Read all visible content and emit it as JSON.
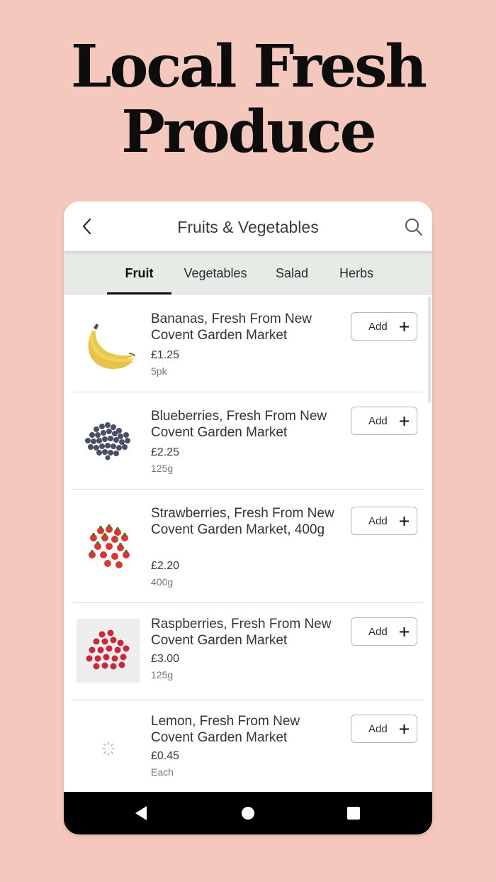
{
  "hero": {
    "line1": "Local Fresh",
    "line2": "Produce"
  },
  "appbar": {
    "title": "Fruits & Vegetables",
    "back_icon": "back-arrow-icon",
    "search_icon": "search-icon"
  },
  "tabs": [
    {
      "label": "Fruit",
      "active": true
    },
    {
      "label": "Vegetables",
      "active": false
    },
    {
      "label": "Salad",
      "active": false
    },
    {
      "label": "Herbs",
      "active": false
    }
  ],
  "products": [
    {
      "name": "Bananas, Fresh From New Covent Garden Market",
      "price": "£1.25",
      "qty": "5pk",
      "add_label": "Add"
    },
    {
      "name": "Blueberries, Fresh From New Covent Garden Market",
      "price": "£2.25",
      "qty": "125g",
      "add_label": "Add"
    },
    {
      "name": "Strawberries, Fresh From New Covent Garden Market, 400g",
      "price": "£2.20",
      "qty": "400g",
      "add_label": "Add"
    },
    {
      "name": "Raspberries, Fresh From New Covent Garden Market",
      "price": "£3.00",
      "qty": "125g",
      "add_label": "Add"
    },
    {
      "name": "Lemon, Fresh From New Covent Garden Market",
      "price": "£0.45",
      "qty": "Each",
      "add_label": "Add"
    }
  ],
  "colors": {
    "background": "#f4c8bd",
    "tabbar": "#e6ebe6",
    "navbar": "#000000"
  },
  "navbar": {
    "back_icon": "nav-back-icon",
    "home_icon": "nav-home-icon",
    "recents_icon": "nav-recents-icon"
  }
}
